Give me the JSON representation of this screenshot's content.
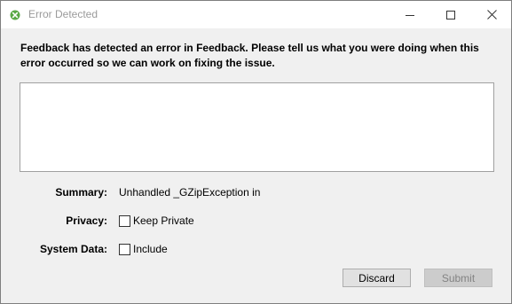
{
  "window": {
    "title": "Error Detected",
    "app_icon": "feedback-app-icon",
    "caption_buttons": {
      "minimize_icon": "minimize-icon",
      "maximize_icon": "maximize-icon",
      "close_icon": "close-icon"
    }
  },
  "dialog": {
    "message": "Feedback has detected an error in Feedback. Please tell us what you were doing when this error occurred so we can work on fixing the issue.",
    "feedback_input": {
      "value": "",
      "placeholder": ""
    },
    "summary": {
      "label": "Summary:",
      "value": "Unhandled _GZipException in"
    },
    "privacy": {
      "label": "Privacy:",
      "checkbox_label": "Keep Private",
      "checked": false
    },
    "system_data": {
      "label": "System Data:",
      "checkbox_label": "Include",
      "checked": false
    },
    "buttons": {
      "discard_label": "Discard",
      "submit_label": "Submit",
      "submit_enabled": false
    }
  },
  "colors": {
    "window_background": "#f0f0f0",
    "titlebar_background": "#ffffff",
    "title_text": "#9a9a9a",
    "app_icon_green": "#5aa845",
    "disabled_text": "#838383"
  }
}
